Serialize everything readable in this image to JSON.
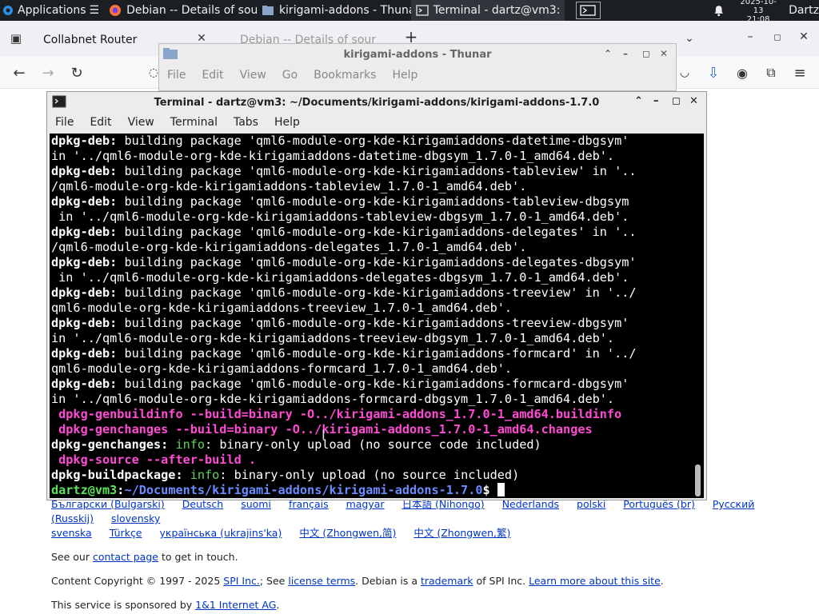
{
  "panel": {
    "applications": "Applications",
    "tasks": [
      {
        "label": "Debian -- Details of sou...",
        "icon": "firefox-icon"
      },
      {
        "label": "kirigami-addons - Thunar",
        "icon": "folder-icon"
      },
      {
        "label": "Terminal - dartz@vm3: ...",
        "icon": "terminal-icon"
      }
    ],
    "date": "2025-10-13",
    "time": "21:08",
    "user": "Dartz"
  },
  "browser": {
    "tabs": [
      {
        "label": "Collabnet Router"
      },
      {
        "label": "Debian -- Details of sour"
      }
    ],
    "new_tab": "+",
    "footer": {
      "languages_row1": [
        "Български (Bulgarski)",
        "Deutsch",
        "suomi",
        "français",
        "magyar",
        "日本語 (Nihongo)",
        "Nederlands",
        "polski",
        "Português (br)",
        "Русский (Russkij)",
        "slovensky"
      ],
      "languages_row2": [
        "svenska",
        "Türkçe",
        "українська (ukrajins'ka)",
        "中文 (Zhongwen,简)",
        "中文 (Zhongwen,繁)"
      ],
      "contact_pre": "See our ",
      "contact_link": "contact page",
      "contact_post": " to get in touch.",
      "copyright_pre": "Content Copyright © 1997 - 2025 ",
      "spi_link": "SPI Inc.",
      "copyright_mid1": "; See ",
      "license_link": "license terms",
      "copyright_mid2": ". Debian is a ",
      "trademark_link": "trademark",
      "copyright_mid3": " of SPI Inc. ",
      "learn_link": "Learn more about this site",
      "copyright_end": ".",
      "sponsor_pre": "This service is sponsored by ",
      "sponsor_link": "1&1 Internet AG",
      "sponsor_end": "."
    }
  },
  "thunar": {
    "title": "kirigami-addons - Thunar",
    "menu": [
      "File",
      "Edit",
      "View",
      "Go",
      "Bookmarks",
      "Help"
    ]
  },
  "terminal": {
    "title": "Terminal - dartz@vm3: ~/Documents/kirigami-addons/kirigami-addons-1.7.0",
    "menu": [
      "File",
      "Edit",
      "View",
      "Terminal",
      "Tabs",
      "Help"
    ],
    "lines": [
      [
        {
          "t": "dpkg-deb:",
          "s": "b"
        },
        {
          "t": " building package 'qml6-module-org-kde-kirigamiaddons-datetime-dbgsym'"
        }
      ],
      [
        {
          "t": "in '../qml6-module-org-kde-kirigamiaddons-datetime-dbgsym_1.7.0-1_amd64.deb'."
        }
      ],
      [
        {
          "t": "dpkg-deb:",
          "s": "b"
        },
        {
          "t": " building package 'qml6-module-org-kde-kirigamiaddons-tableview' in '.."
        }
      ],
      [
        {
          "t": "/qml6-module-org-kde-kirigamiaddons-tableview_1.7.0-1_amd64.deb'."
        }
      ],
      [
        {
          "t": "dpkg-deb:",
          "s": "b"
        },
        {
          "t": " building package 'qml6-module-org-kde-kirigamiaddons-tableview-dbgsym"
        }
      ],
      [
        {
          "t": " in '../qml6-module-org-kde-kirigamiaddons-tableview-dbgsym_1.7.0-1_amd64.deb'."
        }
      ],
      [
        {
          "t": "dpkg-deb:",
          "s": "b"
        },
        {
          "t": " building package 'qml6-module-org-kde-kirigamiaddons-delegates' in '.."
        }
      ],
      [
        {
          "t": "/qml6-module-org-kde-kirigamiaddons-delegates_1.7.0-1_amd64.deb'."
        }
      ],
      [
        {
          "t": "dpkg-deb:",
          "s": "b"
        },
        {
          "t": " building package 'qml6-module-org-kde-kirigamiaddons-delegates-dbgsym'"
        }
      ],
      [
        {
          "t": " in '../qml6-module-org-kde-kirigamiaddons-delegates-dbgsym_1.7.0-1_amd64.deb'."
        }
      ],
      [
        {
          "t": "dpkg-deb:",
          "s": "b"
        },
        {
          "t": " building package 'qml6-module-org-kde-kirigamiaddons-treeview' in '../"
        }
      ],
      [
        {
          "t": "qml6-module-org-kde-kirigamiaddons-treeview_1.7.0-1_amd64.deb'."
        }
      ],
      [
        {
          "t": "dpkg-deb:",
          "s": "b"
        },
        {
          "t": " building package 'qml6-module-org-kde-kirigamiaddons-treeview-dbgsym'"
        }
      ],
      [
        {
          "t": "in '../qml6-module-org-kde-kirigamiaddons-treeview-dbgsym_1.7.0-1_amd64.deb'."
        }
      ],
      [
        {
          "t": "dpkg-deb:",
          "s": "b"
        },
        {
          "t": " building package 'qml6-module-org-kde-kirigamiaddons-formcard' in '../"
        }
      ],
      [
        {
          "t": "qml6-module-org-kde-kirigamiaddons-formcard_1.7.0-1_amd64.deb'."
        }
      ],
      [
        {
          "t": "dpkg-deb:",
          "s": "b"
        },
        {
          "t": " building package 'qml6-module-org-kde-kirigamiaddons-formcard-dbgsym'"
        }
      ],
      [
        {
          "t": "in '../qml6-module-org-kde-kirigamiaddons-formcard-dbgsym_1.7.0-1_amd64.deb'."
        }
      ],
      [
        {
          "t": " dpkg-genbuildinfo --build=binary -O../kirigami-addons_1.7.0-1_amd64.buildinfo",
          "s": "pk"
        }
      ],
      [
        {
          "t": " dpkg-genchanges --build=binary -O../kirigami-addons_1.7.0-1_amd64.changes",
          "s": "pk"
        }
      ],
      [
        {
          "t": "dpkg-genchanges:",
          "s": "b"
        },
        {
          "t": " "
        },
        {
          "t": "info",
          "s": "gr"
        },
        {
          "t": ": binary-only upload (no source code included)"
        }
      ],
      [
        {
          "t": " dpkg-source --after-build .",
          "s": "pk"
        }
      ],
      [
        {
          "t": "dpkg-buildpackage:",
          "s": "b"
        },
        {
          "t": " "
        },
        {
          "t": "info",
          "s": "gr"
        },
        {
          "t": ": binary-only upload (no source included)"
        }
      ]
    ],
    "prompt_user": "dartz@vm3",
    "prompt_sep": ":",
    "prompt_path": "~/Documents/kirigami-addons/kirigami-addons-1.7.0",
    "prompt_symbol": "$ "
  }
}
